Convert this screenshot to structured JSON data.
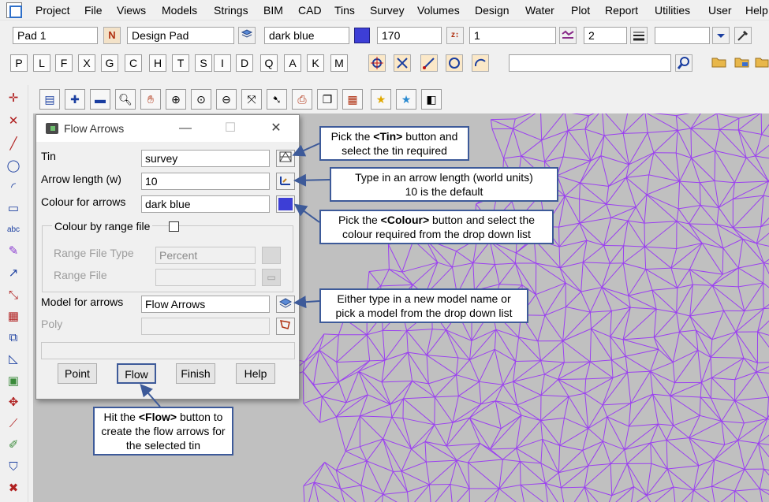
{
  "menubar": {
    "items": [
      "Project",
      "File",
      "Views",
      "Models",
      "Strings",
      "BIM",
      "CAD",
      "Tins",
      "Survey",
      "Volumes",
      "Design",
      "Water",
      "Plot",
      "Report",
      "Utilities",
      "User",
      "Help"
    ]
  },
  "toolbar1": {
    "name_field": "Pad 1",
    "n_button": "N",
    "model_field": "Design Pad",
    "colour_field": "dark blue",
    "colour_value": "#3d3ed6",
    "number_field": "170",
    "style_field": "1",
    "weight_field": "2",
    "blank_field": ""
  },
  "toolbar2": {
    "letters": [
      "P",
      "L",
      "F",
      "X",
      "G",
      "C",
      "H",
      "T",
      "S",
      "I",
      "D",
      "Q",
      "A",
      "K",
      "M"
    ],
    "search_value": ""
  },
  "dialog": {
    "title": "Flow Arrows",
    "tin_label": "Tin",
    "tin_value": "survey",
    "arrow_length_label": "Arrow length (w)",
    "arrow_length_value": "10",
    "colour_label": "Colour for arrows",
    "colour_value": "dark blue",
    "colour_swatch": "#3d3ed6",
    "colour_by_range_label": "Colour by range file",
    "range_file_type_label": "Range File Type",
    "range_file_type_value": "Percent",
    "range_file_label": "Range File",
    "range_file_value": "",
    "model_label": "Model for arrows",
    "model_value": "Flow Arrows",
    "poly_label": "Poly",
    "poly_value": "",
    "message_value": "",
    "buttons": {
      "point": "Point",
      "flow": "Flow",
      "finish": "Finish",
      "help": "Help"
    }
  },
  "callouts": {
    "tin": {
      "pre": "Pick the ",
      "key": "<Tin>",
      "post": " button and select the tin required"
    },
    "length": {
      "line1": "Type in an arrow length (world units)",
      "line2": "10 is the default"
    },
    "colour": {
      "pre": "Pick the ",
      "key": "<Colour>",
      "post": " button and select the colour required from the drop down list"
    },
    "model": {
      "line1": "Either type in a new model name or",
      "line2": "pick a model from the drop down list"
    },
    "flow": {
      "pre": "Hit the ",
      "key": "<Flow>",
      "post": " button to create the flow arrows for the selected tin"
    }
  },
  "colors": {
    "tin_mesh": "#9b3ff0",
    "graphics_bg": "#c0c0c0",
    "callout_border": "#3d5a99"
  }
}
